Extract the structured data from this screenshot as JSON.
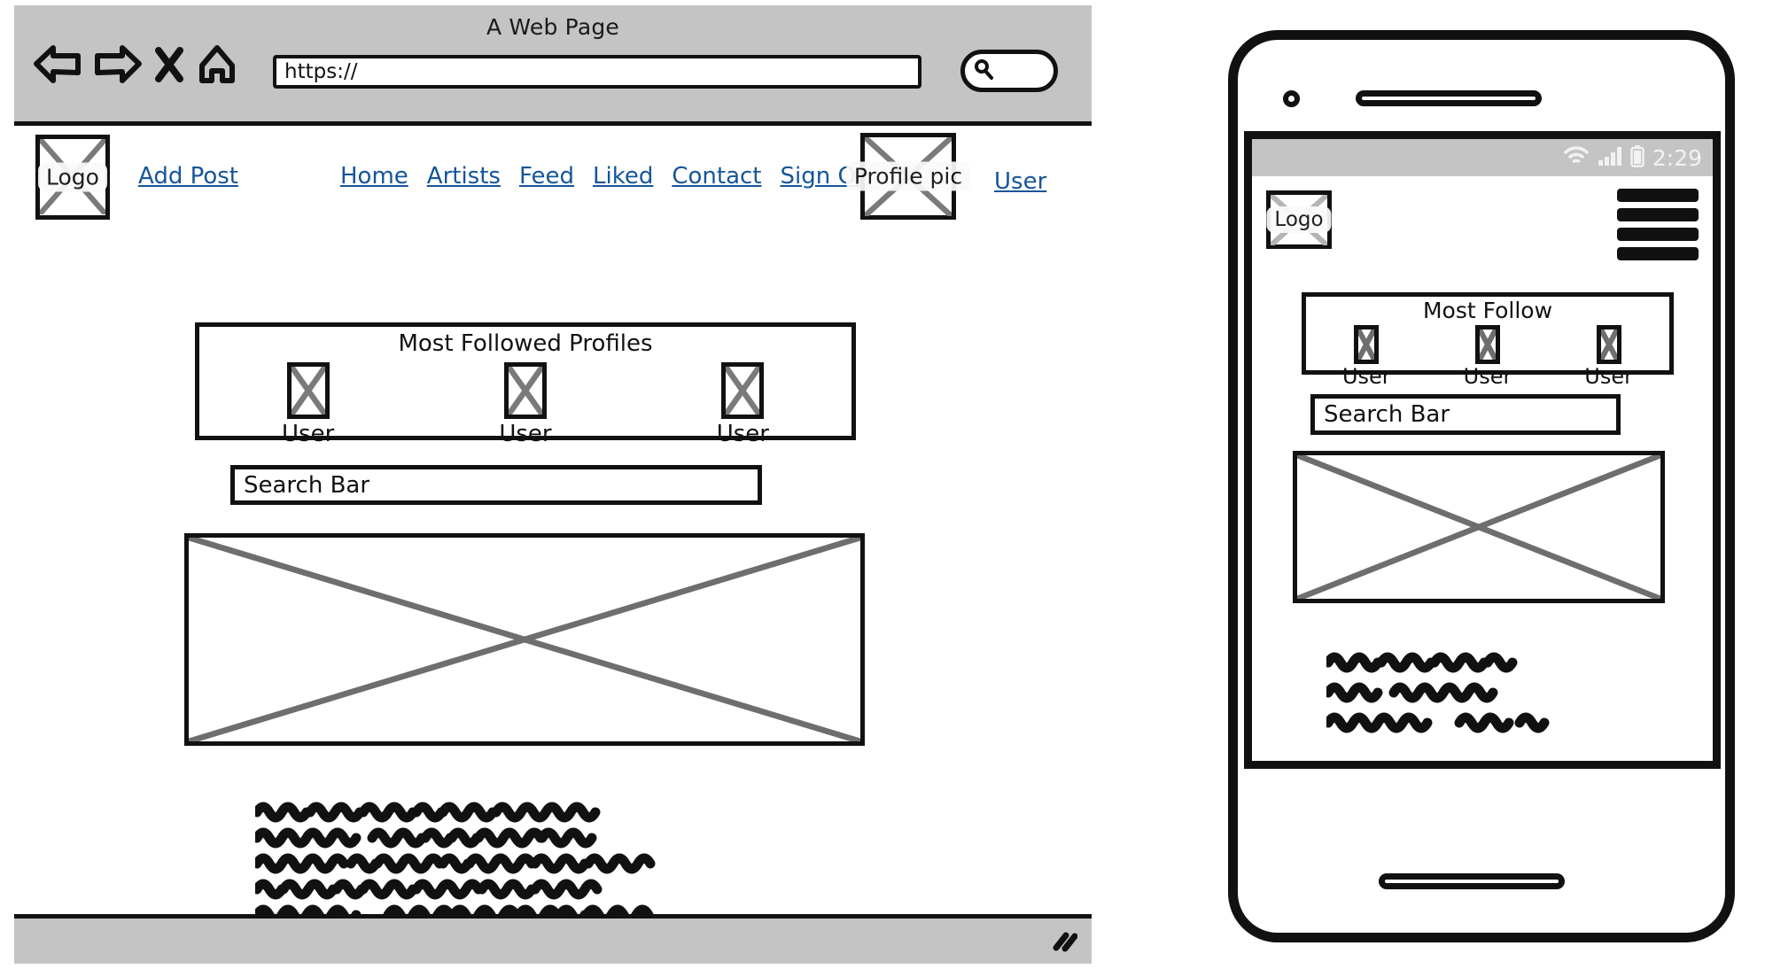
{
  "browser": {
    "window_title": "A Web Page",
    "url_value": "https://",
    "toolbar_icons": [
      "back-arrow-icon",
      "forward-arrow-icon",
      "stop-x-icon",
      "home-icon"
    ],
    "search_icon": "magnifier-icon",
    "search_value": "",
    "resize_grip": "resize-grip-icon"
  },
  "site": {
    "logo_label": "Logo",
    "add_post_label": "Add Post",
    "nav_links": [
      {
        "label": "Home"
      },
      {
        "label": "Artists"
      },
      {
        "label": "Feed"
      },
      {
        "label": "Liked"
      },
      {
        "label": "Contact"
      },
      {
        "label": "Sign Out"
      }
    ],
    "profile_pic_label": "Profile pic",
    "user_link_label": "User",
    "followed_panel": {
      "title": "Most Followed Profiles",
      "profiles": [
        {
          "name": "User"
        },
        {
          "name": "User"
        },
        {
          "name": "User"
        }
      ]
    },
    "search_bar_value": "Search Bar",
    "hero_image": "image-placeholder",
    "body_text_lines": 5
  },
  "phone": {
    "status": {
      "wifi_icon": "wifi-icon",
      "signal_icon": "signal-bars-icon",
      "battery_icon": "battery-icon",
      "time": "2:29"
    },
    "logo_label": "Logo",
    "menu_icon": "hamburger-menu-icon",
    "menu_bars": 4,
    "followed_panel": {
      "title": "Most Follow",
      "profiles": [
        {
          "name": "User"
        },
        {
          "name": "User"
        },
        {
          "name": "User"
        }
      ]
    },
    "search_bar_value": "Search Bar",
    "hero_image": "image-placeholder",
    "body_text_lines": 3,
    "hardware": {
      "camera": "front-camera-dot",
      "speaker": "earpiece-speaker",
      "home_button": "home-button"
    }
  },
  "colors": {
    "link": "#15559a",
    "chrome_gray": "#c4c4c4",
    "ink": "#111111",
    "placeholder_x": "#7a7a7a"
  }
}
